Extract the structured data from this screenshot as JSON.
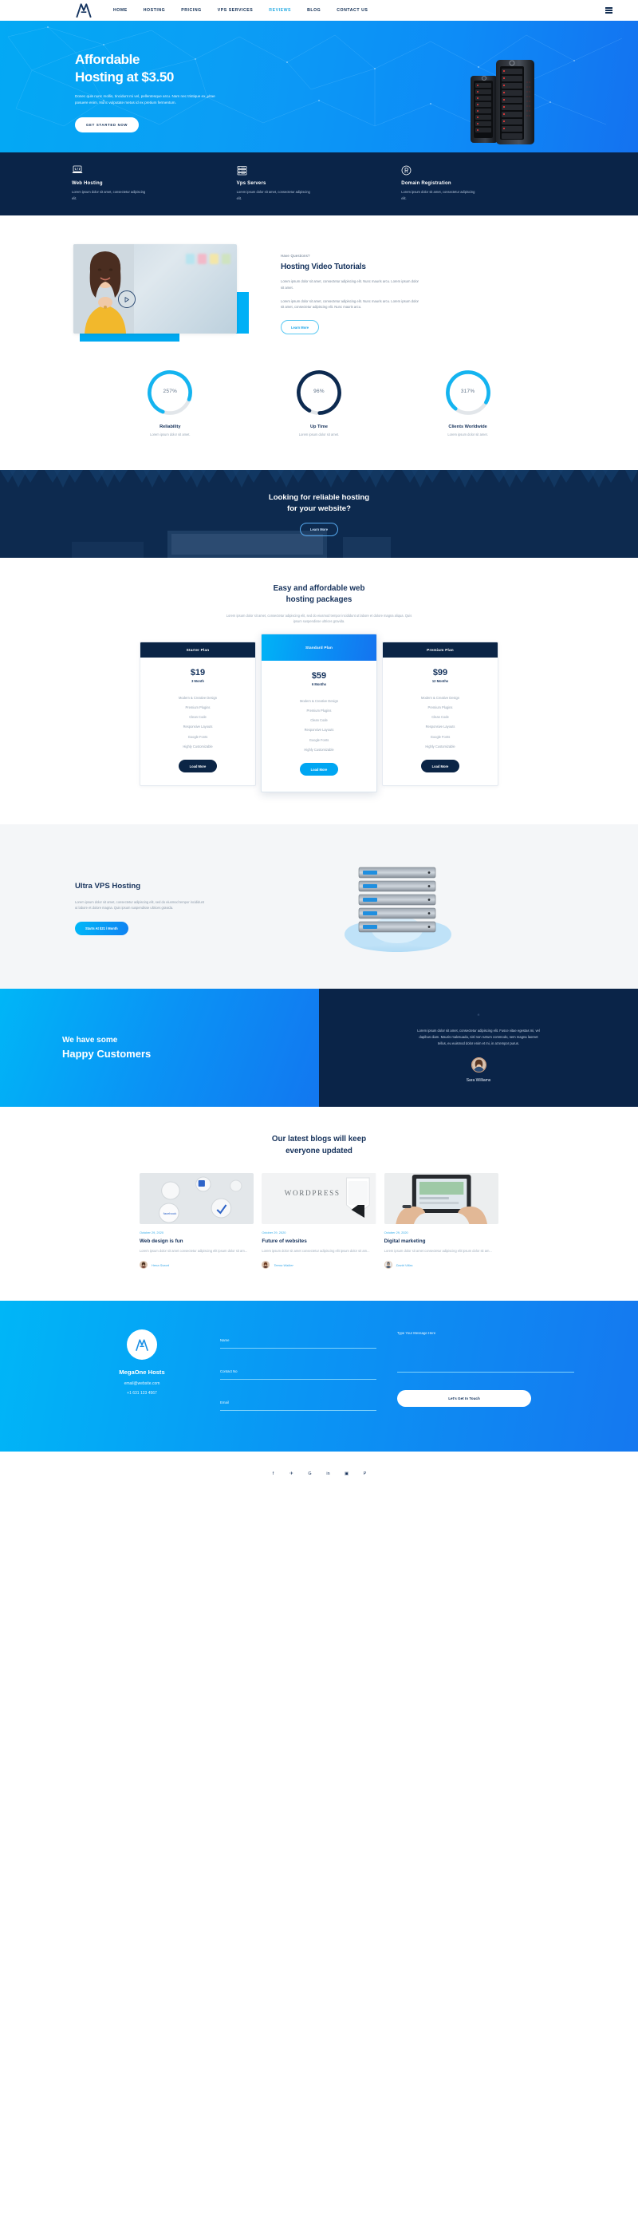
{
  "nav": {
    "logo_icon": "megaone-logo-icon",
    "links": [
      {
        "label": "HOME",
        "active": false
      },
      {
        "label": "HOSTING",
        "active": false
      },
      {
        "label": "PRICING",
        "active": false
      },
      {
        "label": "VPS SERVICES",
        "active": false
      },
      {
        "label": "REVIEWS",
        "active": true
      },
      {
        "label": "BLOG",
        "active": false
      },
      {
        "label": "CONTACT US",
        "active": false
      }
    ],
    "menu_icon": "hamburger-menu-icon",
    "accent_color": "#29ace3"
  },
  "hero": {
    "title_line1": "Affordable",
    "title_line2": "Hosting at $3.50",
    "paragraph": "Donec quis nunc mollis, tincidunt mi vel, pellentesque arcu. Nam nec tristique ex, vitae posuere enim. Nunc vulputate metus id ex pretium fermentum.",
    "cta_label": "GET STARTED NOW",
    "bg_gradient_from": "#03a9f4",
    "bg_gradient_to": "#1472f0"
  },
  "features": {
    "bg_color": "#0a2448",
    "items": [
      {
        "icon": "laptop-code-icon",
        "title": "Web Hosting",
        "desc": "Lorem ipsum dolor sit amet, consectetur adipiscing elit."
      },
      {
        "icon": "server-rack-icon",
        "title": "Vps Servers",
        "desc": "Lorem ipsum dolor sit amet, consectetur adipiscing elit."
      },
      {
        "icon": "registered-trademark-icon",
        "title": "Domain Registration",
        "desc": "Lorem ipsum dolor sit amet, consectetur adipiscing elit."
      }
    ]
  },
  "video": {
    "play_icon": "play-button-icon",
    "eyebrow": "Have Questions?",
    "title": "Hosting Video Tutorials",
    "paragraph1": "Lorem ipsum dolor sit amet, consectetur adipiscing elit. Nunc mauris arcu. Lorem ipsum dolor sit amet.",
    "paragraph2": "Lorem ipsum dolor sit amet, consectetur adipiscing elit. Nunc mauris arcu. Lorem ipsum dolor sit amet, consectetur adipiscing elit. Nunc mauris arcu.",
    "button_label": "Learn More"
  },
  "chart_data": {
    "type": "bar",
    "title": "Hosting statistics donut gauges",
    "categories": [
      "Reliability",
      "Up Time",
      "Clients Worldwide"
    ],
    "values": [
      257,
      96,
      317
    ],
    "value_labels": [
      "257%",
      "96%",
      "317%"
    ],
    "ylabel": "Percent",
    "ylim": [
      0,
      360
    ],
    "colors": [
      "#14b4f0",
      "#0d2a50",
      "#14b4f0"
    ],
    "track_color": "#e2e6ea",
    "descriptions": [
      "Lorem ipsum dolor sit amet.",
      "Lorem ipsum dolor sit amet.",
      "Lorem ipsum dolor sit amet."
    ]
  },
  "cta_banner": {
    "line1": "Looking for reliable hosting",
    "line2": "for your website?",
    "button_label": "Learn More"
  },
  "pricing": {
    "title_line1": "Easy and affordable web",
    "title_line2": "hosting packages",
    "subtitle": "Lorem ipsum dolor sit amet, consectetur adipiscing elit, sed do eiusmod tempor incididunt ut labore et dolore magna aliqua. Quis ipsum suspendisse ultrices gravida.",
    "plans": [
      {
        "name": "Starter Plan",
        "price": "$19",
        "period": "3 Month",
        "featured": false,
        "features": [
          "Modern & Creative Design",
          "Premium Plugins",
          "Clean Code",
          "Responsive Layouts",
          "Google Fonts",
          "Highly Customizable"
        ],
        "button_label": "Load More"
      },
      {
        "name": "Standard Plan",
        "price": "$59",
        "period": "6 Months",
        "featured": true,
        "features": [
          "Modern & Creative Design",
          "Premium Plugins",
          "Clean Code",
          "Responsive Layouts",
          "Google Fonts",
          "Highly Customizable"
        ],
        "button_label": "Load More"
      },
      {
        "name": "Premium Plan",
        "price": "$99",
        "period": "12 Months",
        "featured": false,
        "features": [
          "Modern & Creative Design",
          "Premium Plugins",
          "Clean Code",
          "Responsive Layouts",
          "Google Fonts",
          "Highly Customizable"
        ],
        "button_label": "Load More"
      }
    ]
  },
  "vps": {
    "title": "Ultra VPS Hosting",
    "paragraph": "Lorem ipsum dolor sit amet, consectetur adipiscing elit, sed do eiusmod tempor incididunt ut labore et dolore magna. Quis ipsum suspendisse ultrices gravida.",
    "button_label": "Starts At $21 / Month",
    "illustration_icon": "server-stack-cloud-icon"
  },
  "testimonial": {
    "heading_line1": "We have some",
    "heading_line2": "Happy Customers",
    "quote_icon": "quote-mark-icon",
    "quote": "Lorem ipsum dolor sit amet, consectetur adipiscing elit. Fusce vitae egestas mi, vel dapibus diam. Mauris malesuada, nisl non rutrum commodo, sem magna laoreet tellus, eu euismod dolor enim et mi, in at tempor purus.",
    "author": "Sara Williams",
    "avatar_icon": "author-avatar"
  },
  "blog": {
    "title_line1": "Our latest blogs will keep",
    "title_line2": "everyone updated",
    "posts": [
      {
        "thumb": "social-badges-photo",
        "date": "October 29, 2020",
        "title": "Web design is fun",
        "excerpt": "Lorem ipsum dolor sit amet consectetur adipiscing elit ipsum dolor sit am...",
        "author": "Hena Sword"
      },
      {
        "thumb": "wordpress-photo",
        "date": "October 29, 2020",
        "title": "Future of websites",
        "excerpt": "Lorem ipsum dolor sit amet consectetur adipiscing elit ipsum dolor sit am...",
        "author": "Teena Walker"
      },
      {
        "thumb": "tablet-hands-photo",
        "date": "October 29, 2020",
        "title": "Digital marketing",
        "excerpt": "Lorem ipsum dolor sit amet consectetur adipiscing elit ipsum dolor sit am...",
        "author": "David Villas"
      }
    ]
  },
  "contact": {
    "logo_icon": "megaone-logo-icon",
    "brand": "MegaOne Hosts",
    "email": "email@website.com",
    "phone": "+1 631 123 4567",
    "name_placeholder": "Name",
    "contact_placeholder": "Contact No",
    "email_placeholder": "Email",
    "message_placeholder": "Type Your Message Here",
    "submit_label": "Let's Get In Touch"
  },
  "footer": {
    "social": [
      {
        "icon": "facebook-icon",
        "glyph": "f"
      },
      {
        "icon": "twitter-icon",
        "glyph": "✈"
      },
      {
        "icon": "google-plus-icon",
        "glyph": "G"
      },
      {
        "icon": "linkedin-icon",
        "glyph": "in"
      },
      {
        "icon": "instagram-icon",
        "glyph": "▣"
      },
      {
        "icon": "pinterest-icon",
        "glyph": "P"
      }
    ]
  }
}
